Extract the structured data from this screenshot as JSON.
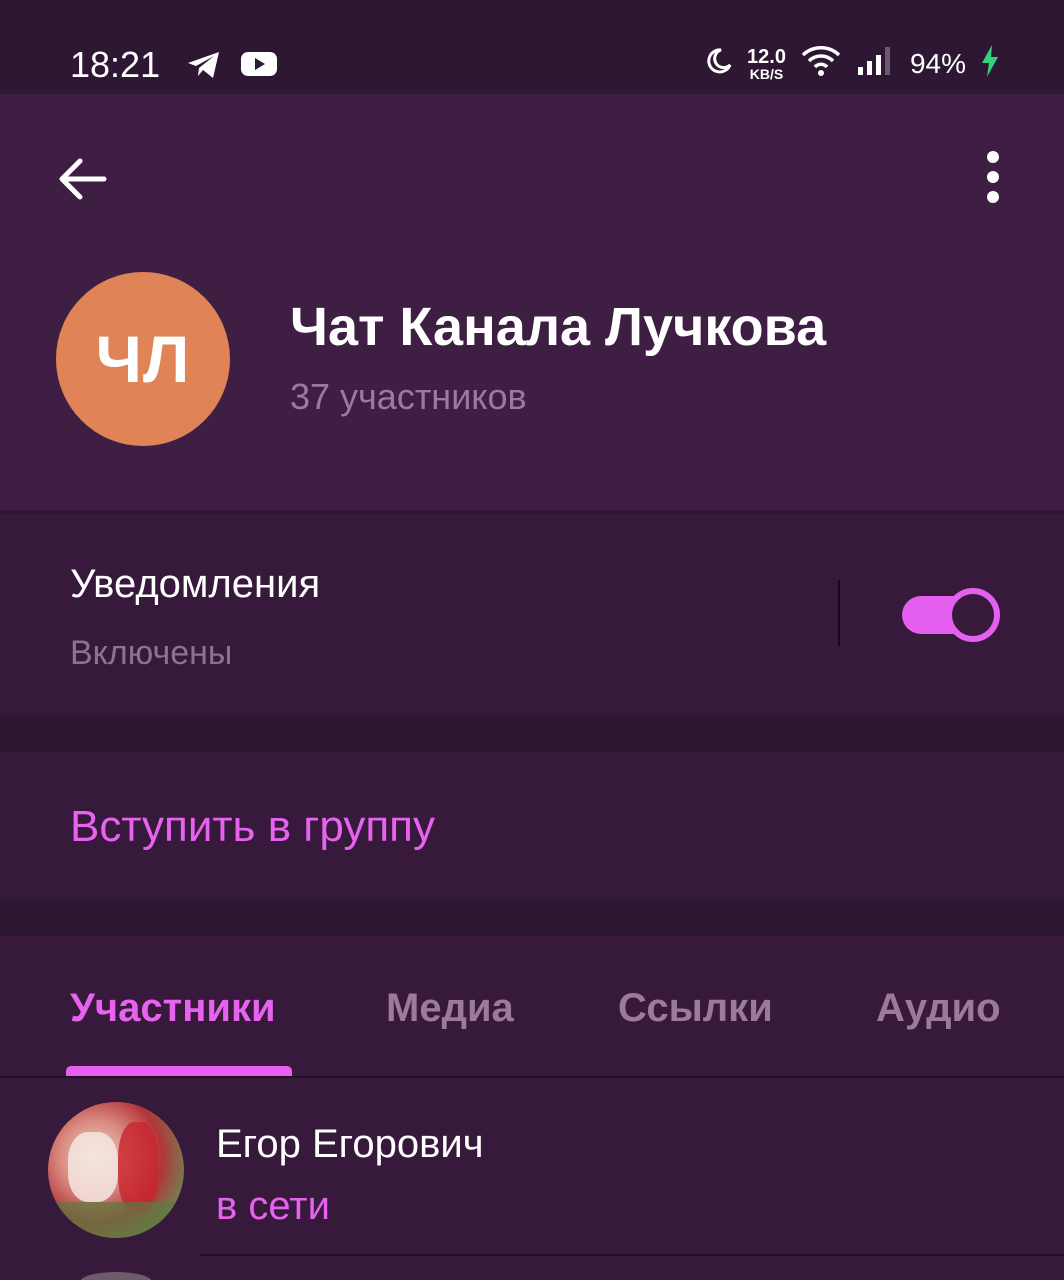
{
  "status_bar": {
    "time": "18:21",
    "net_speed_value": "12.0",
    "net_speed_unit": "KB/S",
    "battery": "94%",
    "icons": [
      "telegram-icon",
      "youtube-icon",
      "moon-icon",
      "wifi-icon",
      "signal-icon",
      "charging-icon"
    ]
  },
  "header": {
    "avatar_initials": "ЧЛ",
    "title": "Чат Канала Лучкова",
    "subtitle": "37 участников",
    "avatar_color": "#e08457"
  },
  "notifications": {
    "title": "Уведомления",
    "subtitle": "Включены",
    "enabled": true
  },
  "join": {
    "label": "Вступить в группу"
  },
  "tabs": [
    {
      "label": "Участники",
      "active": true
    },
    {
      "label": "Медиа",
      "active": false
    },
    {
      "label": "Ссылки",
      "active": false
    },
    {
      "label": "Аудио",
      "active": false
    }
  ],
  "members": [
    {
      "name": "Егор Егорович",
      "status": "в сети"
    }
  ],
  "colors": {
    "accent": "#e660f0",
    "background": "#2e1733",
    "header_bg": "#3e1e42",
    "section_bg": "#371a3b"
  }
}
